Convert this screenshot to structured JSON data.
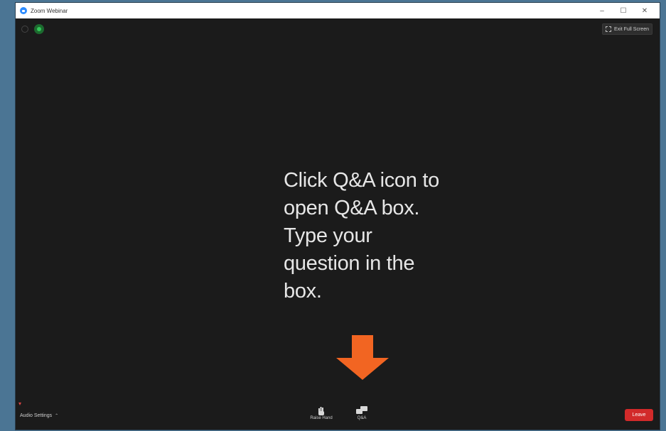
{
  "window": {
    "title": "Zoom Webinar",
    "controls": {
      "minimize": "–",
      "maximize": "☐",
      "close": "✕"
    }
  },
  "meeting": {
    "exit_fullscreen_label": "Exit Full Screen",
    "instruction_text": "Click Q&A icon to\nopen Q&A box.\nType  your\nquestion in the\nbox.",
    "arrow_color": "#f26522"
  },
  "toolbar": {
    "audio_settings_label": "Audio Settings",
    "raise_hand_label": "Raise Hand",
    "qa_label": "Q&A",
    "leave_label": "Leave"
  },
  "colors": {
    "desktop": "#4b7594",
    "meeting_bg": "#1b1b1b",
    "leave_red": "#d22a2a",
    "accent_blue": "#2d8cff"
  }
}
